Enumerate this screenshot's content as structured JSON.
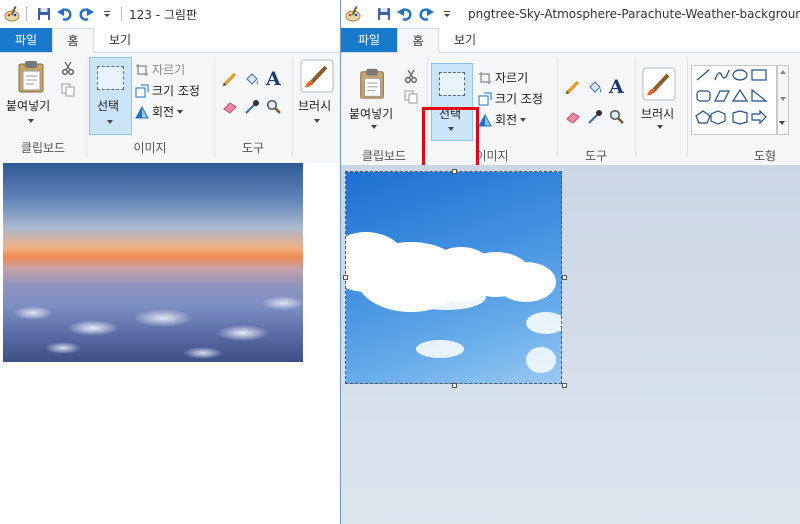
{
  "windowA": {
    "title": "123 - 그림판",
    "tabs": [
      "파일",
      "홈",
      "보기"
    ],
    "clipboard": {
      "paste": "붙여넣기",
      "group": "클립보드"
    },
    "image": {
      "select": "선택",
      "crop": "자르기",
      "resize": "크기 조정",
      "rotate": "회전",
      "group": "이미지"
    },
    "tools": {
      "group": "도구"
    },
    "brushes": {
      "label": "브러시"
    }
  },
  "windowB": {
    "title": "pngtree-Sky-Atmosphere-Parachute-Weather-background-ph",
    "tabs": [
      "파일",
      "홈",
      "보기"
    ],
    "clipboard": {
      "paste": "붙여넣기",
      "group": "클립보드"
    },
    "image": {
      "select": "선택",
      "crop": "자르기",
      "resize": "크기 조정",
      "rotate": "회전",
      "group": "이미지"
    },
    "tools": {
      "group": "도구"
    },
    "brushes": {
      "label": "브러시"
    },
    "shapes": {
      "group": "도형"
    }
  },
  "colors": {
    "file_tab": "#1979ca",
    "highlight": "#e60012",
    "selected_button": "#cce4f7"
  },
  "icons": [
    "paint-app-icon",
    "save-icon",
    "undo-icon",
    "redo-icon",
    "customize-icon",
    "paste-icon",
    "cut-icon",
    "copy-icon",
    "select-icon",
    "crop-icon",
    "resize-icon",
    "rotate-icon",
    "pencil-icon",
    "fill-icon",
    "text-icon",
    "eraser-icon",
    "color-picker-icon",
    "magnifier-icon",
    "brush-icon"
  ]
}
